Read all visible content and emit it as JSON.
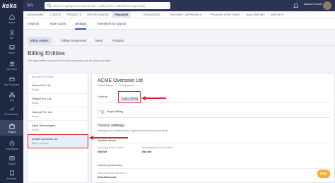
{
  "app": {
    "logo": "keka"
  },
  "rail": [
    {
      "label": "Home",
      "icon": "home-icon"
    },
    {
      "label": "Me",
      "icon": "me-icon"
    },
    {
      "label": "Inbox",
      "icon": "inbox-icon"
    },
    {
      "label": "My Team",
      "icon": "team-icon"
    },
    {
      "label": "My Finances",
      "icon": "finances-icon"
    },
    {
      "label": "Org",
      "icon": "org-icon"
    },
    {
      "label": "Performance",
      "icon": "performance-icon"
    },
    {
      "label": "Project",
      "icon": "project-icon"
    },
    {
      "label": "Time Attend",
      "icon": "time-icon"
    },
    {
      "label": "Payroll",
      "icon": "payroll-icon"
    },
    {
      "label": "Expense",
      "icon": "expense-icon"
    }
  ],
  "topbar": {
    "org": "SPL",
    "search_placeholder": "Search employees or actions (Ex: Apply Leave, Attendance Approvals)",
    "user_name": "Bradrol Kumar",
    "user_sub": "..."
  },
  "nav": [
    "DASHBOARD",
    "CLIENTS",
    "PROJECTS",
    "OPPORTUNITIES",
    "FINANCES",
    "RESOURCES",
    "TIMESHEET APPROVALS",
    "POLICIES & SETTINGS",
    "BULK IMPORT",
    "REPORTS"
  ],
  "subtabs": [
    "Invoices",
    "Rate Cards",
    "Settings",
    "Timesheet for payroll"
  ],
  "billing_tabs": [
    "Billing entities",
    "Billing Frequencies",
    "Taxes",
    "Products"
  ],
  "page": {
    "title": "Billing Entities",
    "subtitle": "The legal entities used to bill or invoice customers can be setup from here."
  },
  "entity_list": {
    "header": "BILLING ENTITIES",
    "items": [
      {
        "name": "Govind Pvt Ltd",
        "status": "Ready"
      },
      {
        "name": "Pethari Pvt. Ltd",
        "status": "Ready"
      },
      {
        "name": "Ganesh Pvt. Ltd",
        "status": "Ready"
      },
      {
        "name": "Keka Technologies",
        "status": "Ready"
      },
      {
        "name": "ACME Overseas Ltd",
        "status": "Billing not setup"
      }
    ]
  },
  "detail": {
    "title": "ACME Overseas Ltd",
    "country": "United States",
    "employees": "0 Employees",
    "tabs": [
      "General",
      "Project Billing"
    ],
    "toggle_label": "Project Billing",
    "invoice_settings": "Invoice settings",
    "invoice_settings_sub": "Manage your number series, payment terms and custom fields.",
    "number_series": "Number series",
    "upcoming_invoice_label": "Upcoming invoice number",
    "upcoming_invoice_value": "Not Set",
    "upcoming_credit_label": "Upcoming credit note number",
    "upcoming_credit_value": "Not Set",
    "invoice_prefs": "Invoice preferences",
    "discount_label": "Discount & taxes applies on",
    "discount_value": "Overall invoice"
  },
  "help": {
    "label": "Help"
  },
  "colors": {
    "accent": "#3f52c4",
    "annotation": "#d7262a",
    "rail": "#1f2841"
  }
}
